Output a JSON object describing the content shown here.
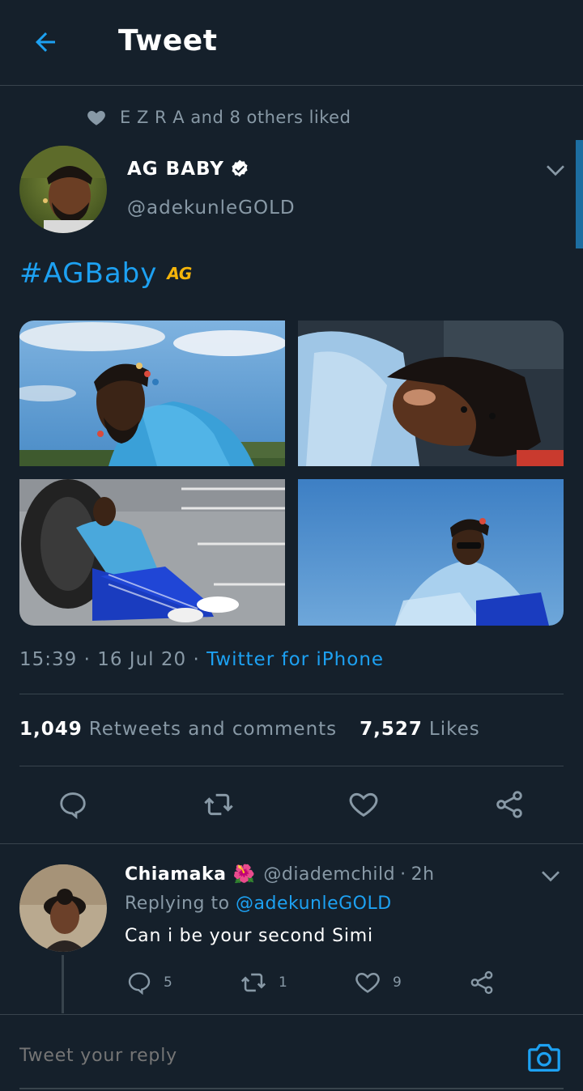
{
  "header": {
    "title": "Tweet",
    "back_icon": "arrow-left-icon"
  },
  "social_context": {
    "text": "E Z R A and 8 others liked",
    "icon": "heart-icon"
  },
  "tweet": {
    "author_name": "AG BABY",
    "verified": true,
    "author_handle": "@adekunleGOLD",
    "text": "#AGBaby",
    "emoji": "AG",
    "time": "15:39",
    "date": "16 Jul 20",
    "source": "Twitter for iPhone",
    "retweets_count": "1,049",
    "retweets_label": "Retweets and comments",
    "likes_count": "7,527",
    "likes_label": "Likes"
  },
  "reply": {
    "name": "Chiamaka",
    "name_emoji": "🌺",
    "handle": "@diademchild",
    "time": "2h",
    "replying_prefix": "Replying to",
    "replying_to": "@adekunleGOLD",
    "text": "Can i be your second Simi",
    "reply_count": "5",
    "retweet_count": "1",
    "like_count": "9"
  },
  "compose": {
    "placeholder": "Tweet your reply"
  },
  "colors": {
    "background": "#15202b",
    "accent": "#1da1f2",
    "secondary_text": "#8899a6",
    "divider": "#38444d"
  }
}
